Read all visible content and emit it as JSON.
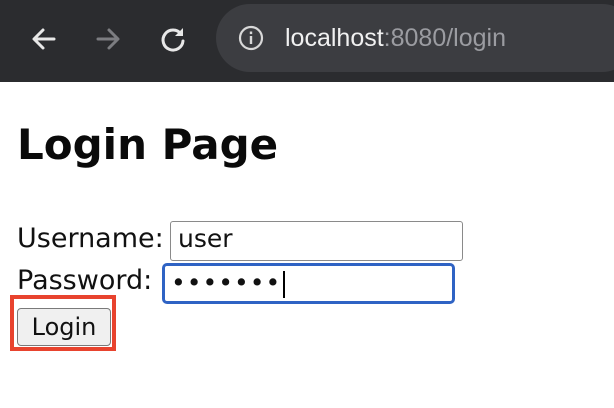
{
  "browser": {
    "url_host": "localhost",
    "url_rest": ":8080/login",
    "icons": {
      "back": "arrow-left-icon",
      "forward": "arrow-right-icon",
      "reload": "reload-icon",
      "info": "info-icon"
    },
    "colors": {
      "toolbar_bg": "#2b2c2f",
      "omnibox_bg": "#3c3d41"
    }
  },
  "page": {
    "title": "Login Page",
    "username_label": "Username:",
    "username_value": "user",
    "password_label": "Password:",
    "password_mask": "•••••••",
    "login_button": "Login"
  },
  "annotation": {
    "highlight_color": "#e8432e",
    "target": "login_button"
  }
}
